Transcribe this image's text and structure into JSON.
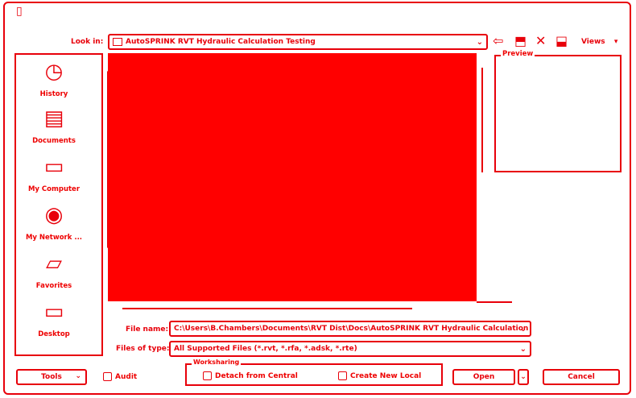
{
  "window": {
    "title_icon": "app-icon"
  },
  "look_in": {
    "label": "Look in:",
    "value": "AutoSPRINK RVT Hydraulic Calculation Testing"
  },
  "toolbar": {
    "back_icon": "back-arrow-icon",
    "up_folder_icon": "up-folder-icon",
    "delete_icon": "close-icon",
    "new_folder_icon": "new-folder-icon",
    "views_label": "Views"
  },
  "places": [
    {
      "label": "History",
      "icon": "history-icon"
    },
    {
      "label": "Documents",
      "icon": "documents-icon"
    },
    {
      "label": "My Computer",
      "icon": "computer-icon"
    },
    {
      "label": "My Network ...",
      "icon": "network-icon"
    },
    {
      "label": "Favorites",
      "icon": "folder-icon"
    },
    {
      "label": "Desktop",
      "icon": "desktop-icon"
    }
  ],
  "preview": {
    "label": "Preview"
  },
  "file_name": {
    "label": "File name:",
    "value": "C:\\Users\\B.Chambers\\Documents\\RVT Dist\\Docs\\AutoSPRINK RVT Hydraulic Calculation"
  },
  "file_type": {
    "label": "Files of type:",
    "value": "All Supported Files  (*.rvt, *.rfa, *.adsk, *.rte)"
  },
  "tools_button": "Tools",
  "audit_label": "Audit",
  "worksharing": {
    "label": "Worksharing",
    "detach_label": "Detach from Central",
    "create_local_label": "Create New Local"
  },
  "open_button": "Open",
  "cancel_button": "Cancel",
  "colors": {
    "accent": "#e8000a",
    "list_fill": "#ff0000"
  }
}
